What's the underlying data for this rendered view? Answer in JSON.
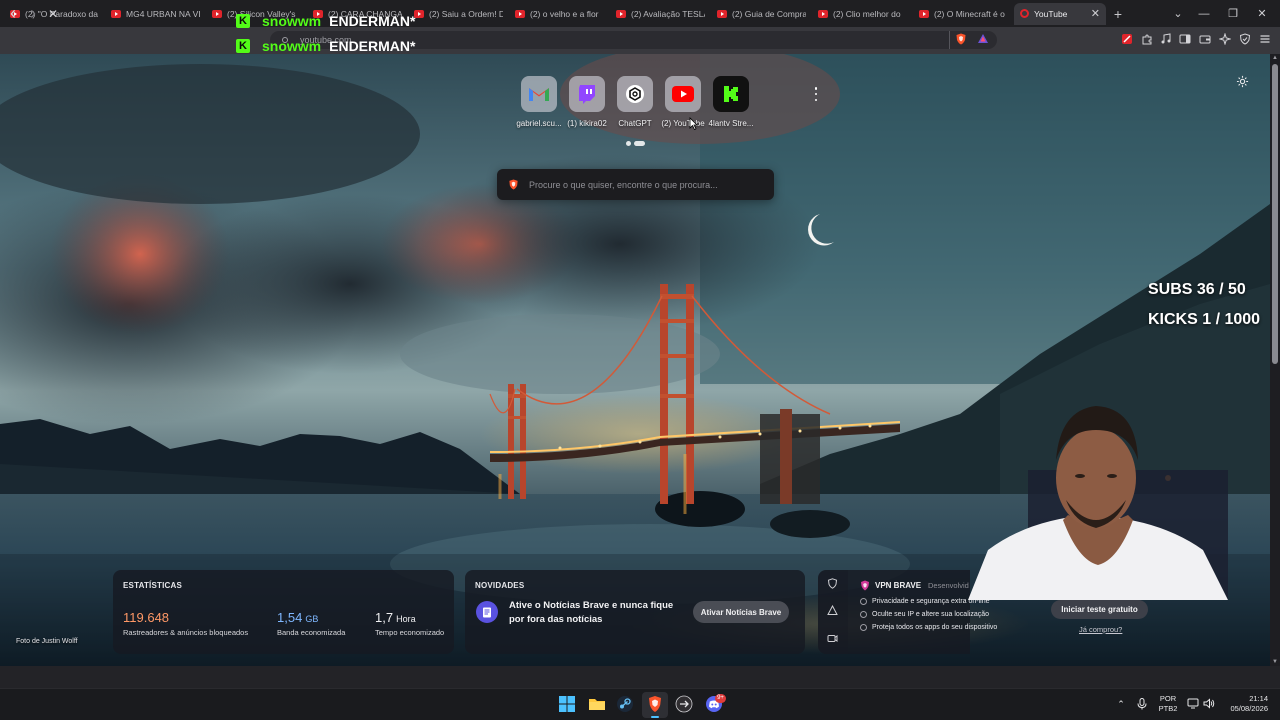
{
  "tabs": [
    {
      "title": "(2) \"O Paradoxo da"
    },
    {
      "title": "MG4 URBAN NA VI"
    },
    {
      "title": "(2) Silicon Valley's"
    },
    {
      "title": "(2) CARA CHANGA"
    },
    {
      "title": "(2) Saiu a Ordem! D"
    },
    {
      "title": "(2) o velho e a flor"
    },
    {
      "title": "(2) Avaliação TESLA"
    },
    {
      "title": "(2) Guia de Compra"
    },
    {
      "title": "(2) Clio melhor do"
    },
    {
      "title": "(2) O Minecraft é o"
    }
  ],
  "active_tab": {
    "title": "YouTube",
    "close": "✕"
  },
  "new_tab_label": "+",
  "window_controls": {
    "dropdown": "⌄",
    "minimize": "—",
    "restore": "❐",
    "close": "✕"
  },
  "toolbar": {
    "back": "‹",
    "forward": "›",
    "stop": "✕",
    "url": "youtube.com"
  },
  "stream_overlay": {
    "lines": [
      {
        "badge": "K",
        "user": "snowwm",
        "name": "ENDERMAN*"
      },
      {
        "badge": "K",
        "user": "snowwm",
        "name": "ENDERMAN*"
      }
    ],
    "subs": "SUBS 36 / 50",
    "kicks": "KICKS 1 / 1000"
  },
  "top_sites": [
    {
      "label": "gabriel.scu...",
      "icon": "gmail-icon"
    },
    {
      "label": "(1) kikira02",
      "icon": "twitch-icon"
    },
    {
      "label": "ChatGPT",
      "icon": "chatgpt-icon"
    },
    {
      "label": "(2) YouTube",
      "icon": "youtube-icon"
    },
    {
      "label": "4lantv Stre...",
      "icon": "kick-icon"
    }
  ],
  "search": {
    "placeholder": "Procure o que quiser, encontre o que procura..."
  },
  "stats": {
    "title": "ESTATÍSTICAS",
    "trackers": {
      "value": "119.648",
      "label": "Rastreadores & anúncios bloqueados"
    },
    "bandwidth": {
      "value": "1,54",
      "unit": "GB",
      "label": "Banda economizada"
    },
    "time": {
      "value": "1,7",
      "unit": "Hora",
      "label": "Tempo economizado"
    }
  },
  "news": {
    "title": "NOVIDADES",
    "text": "Ative o Notícias Brave e nunca fique por fora das notícias",
    "button": "Ativar Notícias Brave"
  },
  "vpn": {
    "title": "VPN BRAVE",
    "subtitle": "Desenvolvid",
    "items": [
      "Privacidade e segurança extra on-line",
      "Oculte seu IP e altere sua localização",
      "Proteja todos os apps do seu dispositivo"
    ],
    "button": "Iniciar teste gratuito",
    "link": "Já comprou?"
  },
  "photo_credit": "Foto de Justin Wolff",
  "taskbar": {
    "lang_line1": "POR",
    "lang_line2": "PTB2",
    "time": "21:14",
    "date": "05/08/2026",
    "discord_badge": "9+"
  },
  "colors": {
    "brave_orange": "#fb542b",
    "kick_green": "#53fc18",
    "stat_orange": "#ff9866",
    "stat_blue": "#7fb7ff",
    "youtube_red": "#ff0000",
    "twitch_purple": "#9146ff"
  }
}
